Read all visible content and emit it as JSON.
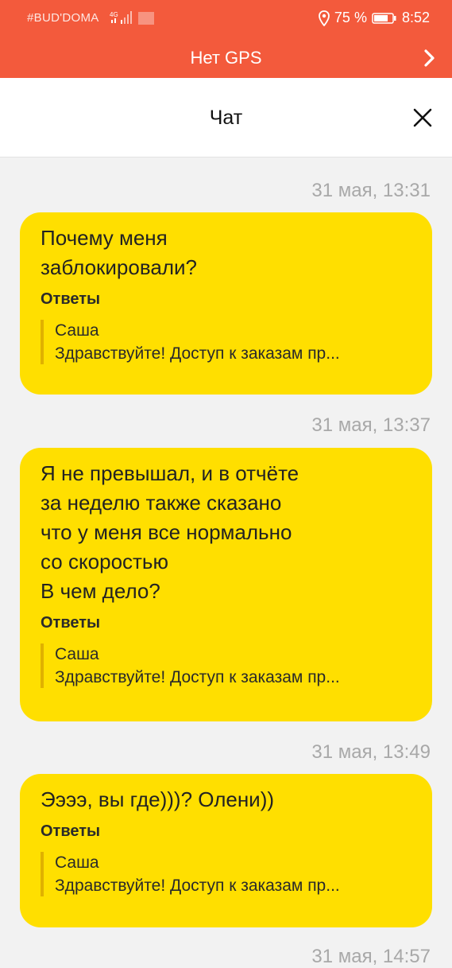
{
  "status_bar": {
    "carrier": "#BUD'DOMA",
    "network": "4G",
    "battery": "75 %",
    "time": "8:52"
  },
  "gps_bar": {
    "title": "Нет GPS"
  },
  "header": {
    "title": "Чат"
  },
  "messages": [
    {
      "time": "31 мая, 13:31",
      "text": "Почему меня\nзаблокировали?",
      "answers_label": "Ответы",
      "reply_name": "Саша",
      "reply_text": "Здравствуйте! Доступ к заказам пр..."
    },
    {
      "time": "31 мая, 13:37",
      "text": "Я не превышал, и в отчёте\nза неделю также сказано\nчто у меня все нормально\nсо скоростью\nВ чем дело?",
      "answers_label": "Ответы",
      "reply_name": "Саша",
      "reply_text": "Здравствуйте! Доступ к заказам пр..."
    },
    {
      "time": "31 мая, 13:49",
      "text": "Ээээ, вы где)))? Олени))",
      "answers_label": "Ответы",
      "reply_name": "Саша",
      "reply_text": "Здравствуйте! Доступ к заказам пр..."
    }
  ],
  "next_time_partial": "31 мая, 14:57",
  "colors": {
    "accent": "#f35a3c",
    "bubble": "#ffdf00",
    "reply_bar": "#e0b100"
  }
}
